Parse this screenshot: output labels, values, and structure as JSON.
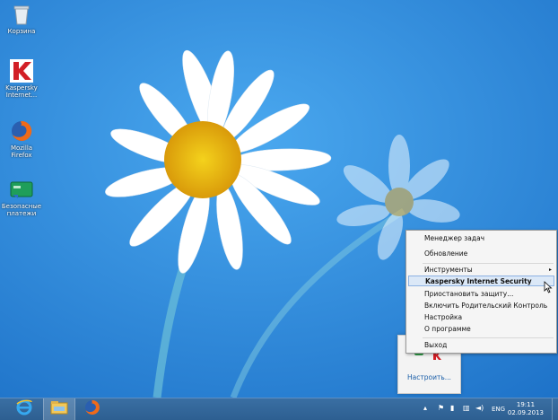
{
  "desktop": {
    "icons": [
      {
        "label": "Корзина",
        "icon": "recycle-bin-icon"
      },
      {
        "label": "Kaspersky\nInternet...",
        "icon": "kaspersky-icon"
      },
      {
        "label": "Mozilla\nFirefox",
        "icon": "firefox-icon"
      },
      {
        "label": "Безопасные\nплатежи",
        "icon": "safe-money-icon"
      }
    ]
  },
  "context_menu": {
    "items": [
      {
        "label": "Менеджер задач"
      },
      {
        "label": "Обновление"
      },
      {
        "label": "Инструменты",
        "arrow": "▸"
      },
      {
        "label": "Kaspersky Internet Security"
      },
      {
        "label": "Приостановить защиту..."
      },
      {
        "label": "Включить Родительский Контроль"
      },
      {
        "label": "Настройка"
      },
      {
        "label": "О программе"
      },
      {
        "label": "Выход"
      }
    ]
  },
  "tray_popup": {
    "customize_label": "Настроить..."
  },
  "taskbar": {
    "pinned": [
      "internet-explorer-icon",
      "file-explorer-icon",
      "firefox-icon"
    ],
    "language": "ENG",
    "time": "19:11",
    "date": "02.09.2013"
  },
  "colors": {
    "accent": "#1f7fd6",
    "taskbar": "#2d5f91",
    "kaspersky_red": "#d21f26"
  }
}
